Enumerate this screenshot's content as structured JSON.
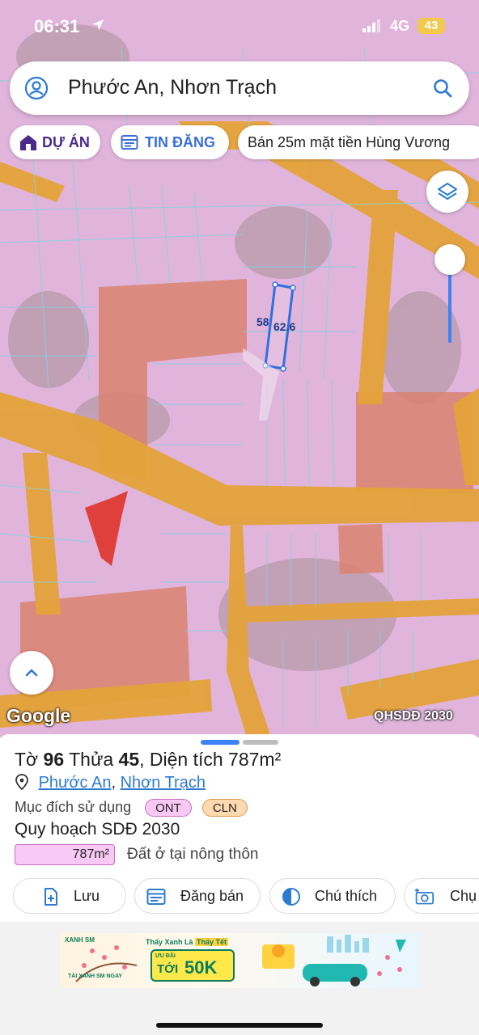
{
  "status_bar": {
    "time": "06:31",
    "network": "4G",
    "battery": "43"
  },
  "search": {
    "query": "Phước An, Nhơn Trạch"
  },
  "chips": {
    "du_an": "DỰ ÁN",
    "tin_dang": "TIN ĐĂNG",
    "listing": "Bán 25m mặt tiền Hùng Vương"
  },
  "map": {
    "parcel_width": "58",
    "parcel_length": "62.6",
    "attribution": "Google",
    "layer_name": "QHSDĐ 2030"
  },
  "sheet": {
    "sheet_label": "Tờ",
    "sheet_no": "96",
    "parcel_label": "Thửa",
    "parcel_no": "45",
    "area_label": ", Diện tích 787m²",
    "ward": "Phước An",
    "separator": ",",
    "district": "Nhơn Trạch",
    "usage_label": "Mục đích sử dụng",
    "usage_tags": [
      "ONT",
      "CLN"
    ],
    "plan_title": "Quy hoạch SDĐ 2030",
    "plan_area": "787m²",
    "plan_description": "Đất ở tại nông thôn",
    "actions": {
      "save": "Lưu",
      "post_sale": "Đăng bán",
      "legend": "Chú thích",
      "capture": "Chụ"
    }
  },
  "ad": {
    "brand": "XANH SM",
    "headline_prefix": "Thấy Xanh Là",
    "headline_highlight": "Thấy Tết",
    "promo_small": "ƯU ĐÃI",
    "promo_prefix": "TỚI",
    "promo_amount": "50K",
    "sub": "TẢI XANH SM NGAY"
  },
  "colors": {
    "residential_zone": "#e8b7e0",
    "road": "#e5a33a",
    "commercial_zone": "#d9836e",
    "highlight_parcel": "#e0403c",
    "accent_blue": "#3b82f6"
  }
}
